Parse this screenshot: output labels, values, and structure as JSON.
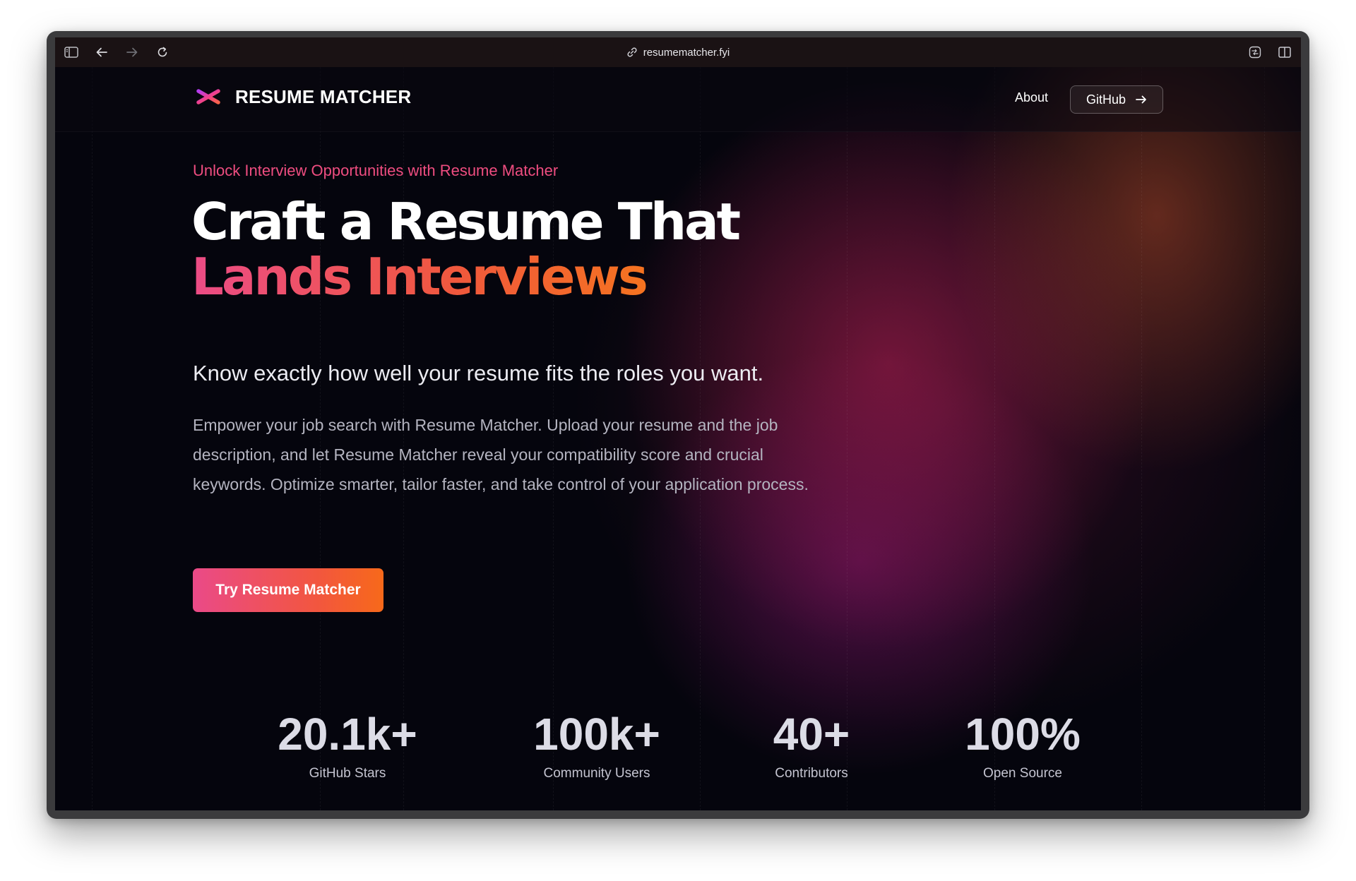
{
  "browser": {
    "url": "resumematcher.fyi"
  },
  "header": {
    "brand": "RESUME MATCHER",
    "nav_about": "About",
    "github_label": "GitHub"
  },
  "hero": {
    "eyebrow": "Unlock Interview Opportunities with Resume Matcher",
    "headline_line1": "Craft a Resume That",
    "headline_line2": "Lands Interviews",
    "subhead": "Know exactly how well your resume fits the roles you want.",
    "description": "Empower your job search with Resume Matcher. Upload your resume and the job description, and let Resume Matcher reveal your compatibility score and crucial keywords. Optimize smarter, tailor faster, and take control of your application process.",
    "cta_label": "Try Resume Matcher"
  },
  "stats": [
    {
      "value": "20.1k+",
      "label": "GitHub Stars"
    },
    {
      "value": "100k+",
      "label": "Community Users"
    },
    {
      "value": "40+",
      "label": "Contributors"
    },
    {
      "value": "100%",
      "label": "Open Source"
    }
  ],
  "colors": {
    "accent_pink": "#ec4c86",
    "accent_orange": "#f57320",
    "background": "#05050d"
  }
}
